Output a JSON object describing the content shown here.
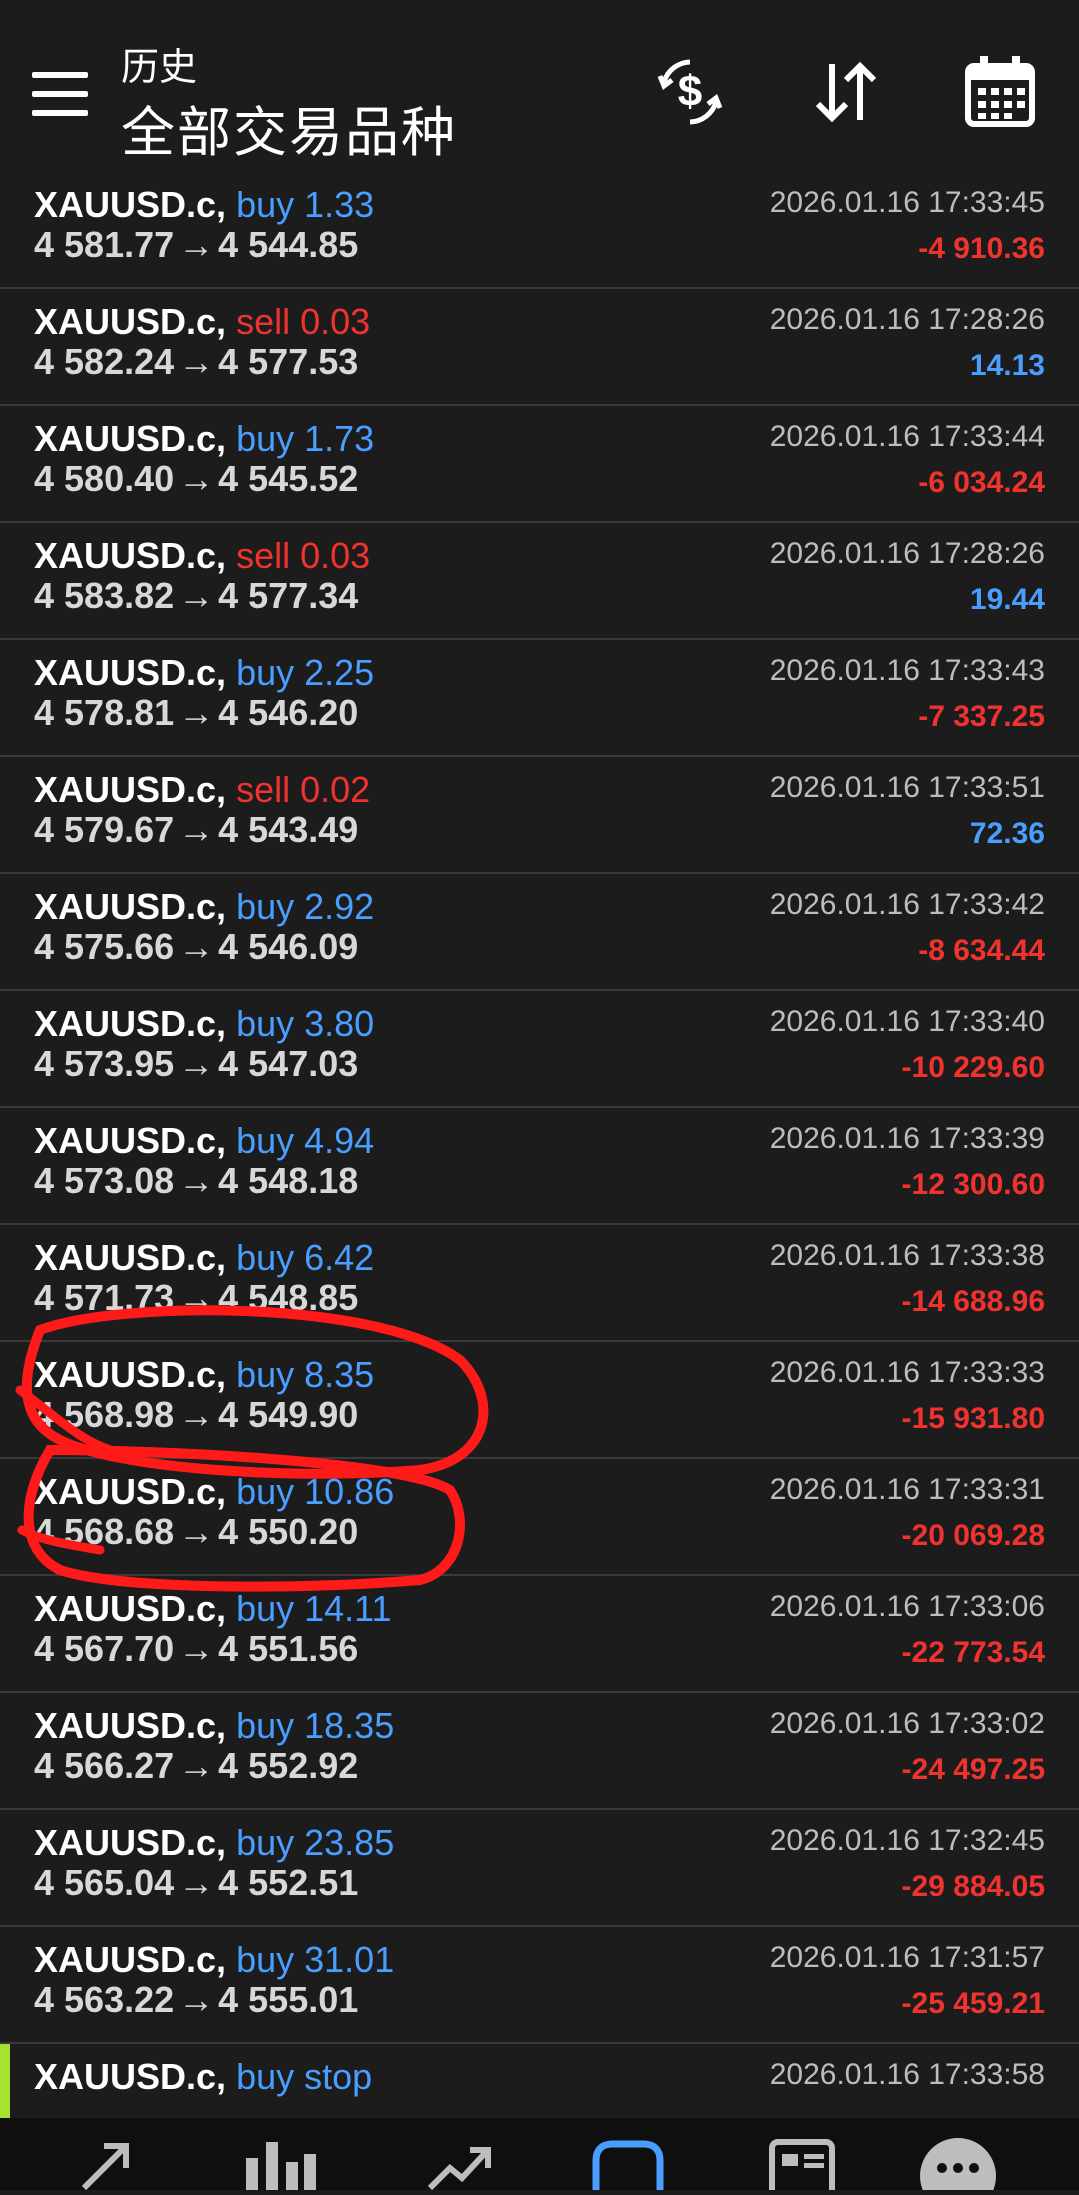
{
  "header": {
    "subtitle": "历史",
    "title": "全部交易品种"
  },
  "icons": {
    "menu": "hamburger-menu-icon",
    "currency": "dollar-exchange-icon",
    "sort": "sort-arrows-icon",
    "calendar": "calendar-icon"
  },
  "colors": {
    "buy": "#4a9eff",
    "sell": "#f0332e",
    "background": "#1c1c1c",
    "pending_marker": "#a6e22e"
  },
  "trades": [
    {
      "symbol": "XAUUSD.c,",
      "side": "buy",
      "volume": "1.33",
      "open": "4 581.77",
      "close": "4 544.85",
      "time": "2026.01.16 17:33:45",
      "profit": "-4 910.36",
      "profit_sign": "neg"
    },
    {
      "symbol": "XAUUSD.c,",
      "side": "sell",
      "volume": "0.03",
      "open": "4 582.24",
      "close": "4 577.53",
      "time": "2026.01.16 17:28:26",
      "profit": "14.13",
      "profit_sign": "pos"
    },
    {
      "symbol": "XAUUSD.c,",
      "side": "buy",
      "volume": "1.73",
      "open": "4 580.40",
      "close": "4 545.52",
      "time": "2026.01.16 17:33:44",
      "profit": "-6 034.24",
      "profit_sign": "neg"
    },
    {
      "symbol": "XAUUSD.c,",
      "side": "sell",
      "volume": "0.03",
      "open": "4 583.82",
      "close": "4 577.34",
      "time": "2026.01.16 17:28:26",
      "profit": "19.44",
      "profit_sign": "pos"
    },
    {
      "symbol": "XAUUSD.c,",
      "side": "buy",
      "volume": "2.25",
      "open": "4 578.81",
      "close": "4 546.20",
      "time": "2026.01.16 17:33:43",
      "profit": "-7 337.25",
      "profit_sign": "neg"
    },
    {
      "symbol": "XAUUSD.c,",
      "side": "sell",
      "volume": "0.02",
      "open": "4 579.67",
      "close": "4 543.49",
      "time": "2026.01.16 17:33:51",
      "profit": "72.36",
      "profit_sign": "pos"
    },
    {
      "symbol": "XAUUSD.c,",
      "side": "buy",
      "volume": "2.92",
      "open": "4 575.66",
      "close": "4 546.09",
      "time": "2026.01.16 17:33:42",
      "profit": "-8 634.44",
      "profit_sign": "neg"
    },
    {
      "symbol": "XAUUSD.c,",
      "side": "buy",
      "volume": "3.80",
      "open": "4 573.95",
      "close": "4 547.03",
      "time": "2026.01.16 17:33:40",
      "profit": "-10 229.60",
      "profit_sign": "neg"
    },
    {
      "symbol": "XAUUSD.c,",
      "side": "buy",
      "volume": "4.94",
      "open": "4 573.08",
      "close": "4 548.18",
      "time": "2026.01.16 17:33:39",
      "profit": "-12 300.60",
      "profit_sign": "neg"
    },
    {
      "symbol": "XAUUSD.c,",
      "side": "buy",
      "volume": "6.42",
      "open": "4 571.73",
      "close": "4 548.85",
      "time": "2026.01.16 17:33:38",
      "profit": "-14 688.96",
      "profit_sign": "neg"
    },
    {
      "symbol": "XAUUSD.c,",
      "side": "buy",
      "volume": "8.35",
      "open": "4 568.98",
      "close": "4 549.90",
      "time": "2026.01.16 17:33:33",
      "profit": "-15 931.80",
      "profit_sign": "neg"
    },
    {
      "symbol": "XAUUSD.c,",
      "side": "buy",
      "volume": "10.86",
      "open": "4 568.68",
      "close": "4 550.20",
      "time": "2026.01.16 17:33:31",
      "profit": "-20 069.28",
      "profit_sign": "neg"
    },
    {
      "symbol": "XAUUSD.c,",
      "side": "buy",
      "volume": "14.11",
      "open": "4 567.70",
      "close": "4 551.56",
      "time": "2026.01.16 17:33:06",
      "profit": "-22 773.54",
      "profit_sign": "neg"
    },
    {
      "symbol": "XAUUSD.c,",
      "side": "buy",
      "volume": "18.35",
      "open": "4 566.27",
      "close": "4 552.92",
      "time": "2026.01.16 17:33:02",
      "profit": "-24 497.25",
      "profit_sign": "neg"
    },
    {
      "symbol": "XAUUSD.c,",
      "side": "buy",
      "volume": "23.85",
      "open": "4 565.04",
      "close": "4 552.51",
      "time": "2026.01.16 17:32:45",
      "profit": "-29 884.05",
      "profit_sign": "neg"
    },
    {
      "symbol": "XAUUSD.c,",
      "side": "buy",
      "volume": "31.01",
      "open": "4 563.22",
      "close": "4 555.01",
      "time": "2026.01.16 17:31:57",
      "profit": "-25 459.21",
      "profit_sign": "neg"
    },
    {
      "symbol": "XAUUSD.c,",
      "side": "buy stop",
      "volume": "",
      "open": "",
      "close": "",
      "time": "2026.01.16 17:33:58",
      "profit": "",
      "profit_sign": "neg",
      "pending": true
    }
  ],
  "bottom_nav": [
    {
      "icon": "quotes-icon",
      "active": false
    },
    {
      "icon": "chart-icon",
      "active": false
    },
    {
      "icon": "trade-icon",
      "active": false
    },
    {
      "icon": "history-icon",
      "active": true
    },
    {
      "icon": "news-icon",
      "active": false
    },
    {
      "icon": "chat-icon",
      "active": false
    }
  ]
}
